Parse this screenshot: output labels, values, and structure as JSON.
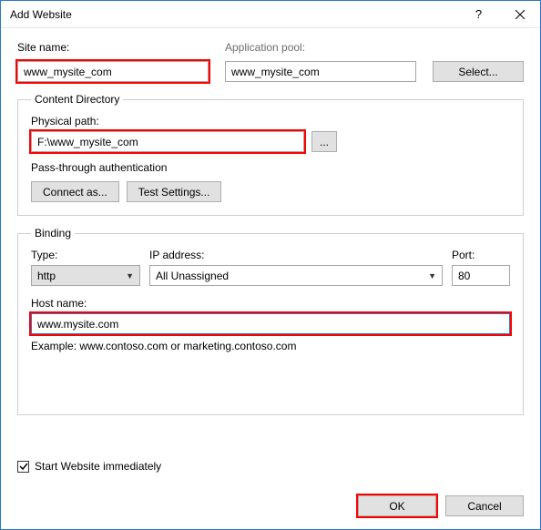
{
  "window": {
    "title": "Add Website"
  },
  "site": {
    "label": "Site name:",
    "value": "www_mysite_com"
  },
  "app_pool": {
    "label": "Application pool:",
    "value": "www_mysite_com",
    "select_btn": "Select..."
  },
  "content_dir": {
    "legend": "Content Directory",
    "path_label": "Physical path:",
    "path_value": "F:\\www_mysite_com",
    "ellipsis": "...",
    "auth_label": "Pass-through authentication",
    "connect_btn": "Connect as...",
    "test_btn": "Test Settings..."
  },
  "binding": {
    "legend": "Binding",
    "type_label": "Type:",
    "type_value": "http",
    "ip_label": "IP address:",
    "ip_value": "All Unassigned",
    "port_label": "Port:",
    "port_value": "80",
    "host_label": "Host name:",
    "host_value": "www.mysite.com",
    "example": "Example: www.contoso.com or marketing.contoso.com"
  },
  "start_checkbox": {
    "checked": true,
    "label": "Start Website immediately"
  },
  "buttons": {
    "ok": "OK",
    "cancel": "Cancel"
  }
}
